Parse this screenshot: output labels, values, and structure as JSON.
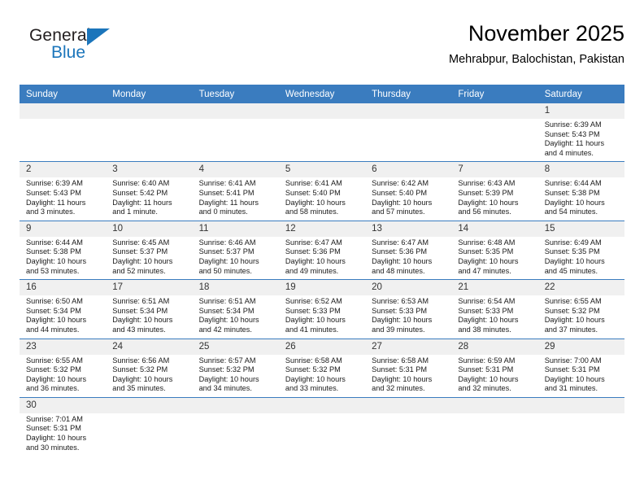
{
  "logo": {
    "word1": "General",
    "word2": "Blue",
    "triangle_color": "#1b75bb",
    "icon": "triangle-icon"
  },
  "header": {
    "title": "November 2025",
    "location": "Mehrabpur, Balochistan, Pakistan"
  },
  "theme": {
    "header_blue": "#3a7cbf",
    "daynum_band": "#f0f0f0",
    "text": "#000000"
  },
  "weekdays": [
    "Sunday",
    "Monday",
    "Tuesday",
    "Wednesday",
    "Thursday",
    "Friday",
    "Saturday"
  ],
  "labels": {
    "sunrise": "Sunrise:",
    "sunset": "Sunset:",
    "daylight": "Daylight:"
  },
  "weeks": [
    [
      {
        "day": "",
        "empty": true
      },
      {
        "day": "",
        "empty": true
      },
      {
        "day": "",
        "empty": true
      },
      {
        "day": "",
        "empty": true
      },
      {
        "day": "",
        "empty": true
      },
      {
        "day": "",
        "empty": true
      },
      {
        "day": "1",
        "sunrise": "Sunrise: 6:39 AM",
        "sunset": "Sunset: 5:43 PM",
        "daylight_line1": "Daylight: 11 hours",
        "daylight_line2": "and 4 minutes."
      }
    ],
    [
      {
        "day": "2",
        "sunrise": "Sunrise: 6:39 AM",
        "sunset": "Sunset: 5:43 PM",
        "daylight_line1": "Daylight: 11 hours",
        "daylight_line2": "and 3 minutes."
      },
      {
        "day": "3",
        "sunrise": "Sunrise: 6:40 AM",
        "sunset": "Sunset: 5:42 PM",
        "daylight_line1": "Daylight: 11 hours",
        "daylight_line2": "and 1 minute."
      },
      {
        "day": "4",
        "sunrise": "Sunrise: 6:41 AM",
        "sunset": "Sunset: 5:41 PM",
        "daylight_line1": "Daylight: 11 hours",
        "daylight_line2": "and 0 minutes."
      },
      {
        "day": "5",
        "sunrise": "Sunrise: 6:41 AM",
        "sunset": "Sunset: 5:40 PM",
        "daylight_line1": "Daylight: 10 hours",
        "daylight_line2": "and 58 minutes."
      },
      {
        "day": "6",
        "sunrise": "Sunrise: 6:42 AM",
        "sunset": "Sunset: 5:40 PM",
        "daylight_line1": "Daylight: 10 hours",
        "daylight_line2": "and 57 minutes."
      },
      {
        "day": "7",
        "sunrise": "Sunrise: 6:43 AM",
        "sunset": "Sunset: 5:39 PM",
        "daylight_line1": "Daylight: 10 hours",
        "daylight_line2": "and 56 minutes."
      },
      {
        "day": "8",
        "sunrise": "Sunrise: 6:44 AM",
        "sunset": "Sunset: 5:38 PM",
        "daylight_line1": "Daylight: 10 hours",
        "daylight_line2": "and 54 minutes."
      }
    ],
    [
      {
        "day": "9",
        "sunrise": "Sunrise: 6:44 AM",
        "sunset": "Sunset: 5:38 PM",
        "daylight_line1": "Daylight: 10 hours",
        "daylight_line2": "and 53 minutes."
      },
      {
        "day": "10",
        "sunrise": "Sunrise: 6:45 AM",
        "sunset": "Sunset: 5:37 PM",
        "daylight_line1": "Daylight: 10 hours",
        "daylight_line2": "and 52 minutes."
      },
      {
        "day": "11",
        "sunrise": "Sunrise: 6:46 AM",
        "sunset": "Sunset: 5:37 PM",
        "daylight_line1": "Daylight: 10 hours",
        "daylight_line2": "and 50 minutes."
      },
      {
        "day": "12",
        "sunrise": "Sunrise: 6:47 AM",
        "sunset": "Sunset: 5:36 PM",
        "daylight_line1": "Daylight: 10 hours",
        "daylight_line2": "and 49 minutes."
      },
      {
        "day": "13",
        "sunrise": "Sunrise: 6:47 AM",
        "sunset": "Sunset: 5:36 PM",
        "daylight_line1": "Daylight: 10 hours",
        "daylight_line2": "and 48 minutes."
      },
      {
        "day": "14",
        "sunrise": "Sunrise: 6:48 AM",
        "sunset": "Sunset: 5:35 PM",
        "daylight_line1": "Daylight: 10 hours",
        "daylight_line2": "and 47 minutes."
      },
      {
        "day": "15",
        "sunrise": "Sunrise: 6:49 AM",
        "sunset": "Sunset: 5:35 PM",
        "daylight_line1": "Daylight: 10 hours",
        "daylight_line2": "and 45 minutes."
      }
    ],
    [
      {
        "day": "16",
        "sunrise": "Sunrise: 6:50 AM",
        "sunset": "Sunset: 5:34 PM",
        "daylight_line1": "Daylight: 10 hours",
        "daylight_line2": "and 44 minutes."
      },
      {
        "day": "17",
        "sunrise": "Sunrise: 6:51 AM",
        "sunset": "Sunset: 5:34 PM",
        "daylight_line1": "Daylight: 10 hours",
        "daylight_line2": "and 43 minutes."
      },
      {
        "day": "18",
        "sunrise": "Sunrise: 6:51 AM",
        "sunset": "Sunset: 5:34 PM",
        "daylight_line1": "Daylight: 10 hours",
        "daylight_line2": "and 42 minutes."
      },
      {
        "day": "19",
        "sunrise": "Sunrise: 6:52 AM",
        "sunset": "Sunset: 5:33 PM",
        "daylight_line1": "Daylight: 10 hours",
        "daylight_line2": "and 41 minutes."
      },
      {
        "day": "20",
        "sunrise": "Sunrise: 6:53 AM",
        "sunset": "Sunset: 5:33 PM",
        "daylight_line1": "Daylight: 10 hours",
        "daylight_line2": "and 39 minutes."
      },
      {
        "day": "21",
        "sunrise": "Sunrise: 6:54 AM",
        "sunset": "Sunset: 5:33 PM",
        "daylight_line1": "Daylight: 10 hours",
        "daylight_line2": "and 38 minutes."
      },
      {
        "day": "22",
        "sunrise": "Sunrise: 6:55 AM",
        "sunset": "Sunset: 5:32 PM",
        "daylight_line1": "Daylight: 10 hours",
        "daylight_line2": "and 37 minutes."
      }
    ],
    [
      {
        "day": "23",
        "sunrise": "Sunrise: 6:55 AM",
        "sunset": "Sunset: 5:32 PM",
        "daylight_line1": "Daylight: 10 hours",
        "daylight_line2": "and 36 minutes."
      },
      {
        "day": "24",
        "sunrise": "Sunrise: 6:56 AM",
        "sunset": "Sunset: 5:32 PM",
        "daylight_line1": "Daylight: 10 hours",
        "daylight_line2": "and 35 minutes."
      },
      {
        "day": "25",
        "sunrise": "Sunrise: 6:57 AM",
        "sunset": "Sunset: 5:32 PM",
        "daylight_line1": "Daylight: 10 hours",
        "daylight_line2": "and 34 minutes."
      },
      {
        "day": "26",
        "sunrise": "Sunrise: 6:58 AM",
        "sunset": "Sunset: 5:32 PM",
        "daylight_line1": "Daylight: 10 hours",
        "daylight_line2": "and 33 minutes."
      },
      {
        "day": "27",
        "sunrise": "Sunrise: 6:58 AM",
        "sunset": "Sunset: 5:31 PM",
        "daylight_line1": "Daylight: 10 hours",
        "daylight_line2": "and 32 minutes."
      },
      {
        "day": "28",
        "sunrise": "Sunrise: 6:59 AM",
        "sunset": "Sunset: 5:31 PM",
        "daylight_line1": "Daylight: 10 hours",
        "daylight_line2": "and 32 minutes."
      },
      {
        "day": "29",
        "sunrise": "Sunrise: 7:00 AM",
        "sunset": "Sunset: 5:31 PM",
        "daylight_line1": "Daylight: 10 hours",
        "daylight_line2": "and 31 minutes."
      }
    ],
    [
      {
        "day": "30",
        "sunrise": "Sunrise: 7:01 AM",
        "sunset": "Sunset: 5:31 PM",
        "daylight_line1": "Daylight: 10 hours",
        "daylight_line2": "and 30 minutes."
      },
      {
        "day": "",
        "empty": true
      },
      {
        "day": "",
        "empty": true
      },
      {
        "day": "",
        "empty": true
      },
      {
        "day": "",
        "empty": true
      },
      {
        "day": "",
        "empty": true
      },
      {
        "day": "",
        "empty": true
      }
    ]
  ]
}
